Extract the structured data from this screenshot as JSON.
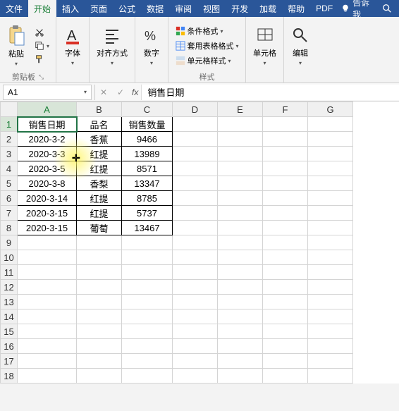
{
  "menubar": {
    "file": "文件",
    "tabs": [
      "开始",
      "插入",
      "页面",
      "公式",
      "数据",
      "审阅",
      "视图",
      "开发",
      "加载",
      "帮助",
      "PDF"
    ],
    "active_index": 0,
    "tellme": "告诉我"
  },
  "ribbon": {
    "clipboard": {
      "paste": "粘贴",
      "label": "剪贴板"
    },
    "font": {
      "label": "字体"
    },
    "align": {
      "label": "对齐方式"
    },
    "number": {
      "label": "数字"
    },
    "styles": {
      "cond_fmt": "条件格式",
      "fmt_table": "套用表格格式",
      "cell_styles": "单元格样式",
      "label": "样式"
    },
    "cells": {
      "label": "单元格"
    },
    "edit": {
      "label": "编辑"
    }
  },
  "namebox": {
    "ref": "A1"
  },
  "formula": {
    "value": "销售日期"
  },
  "chart_data": {
    "type": "table",
    "headers": [
      "销售日期",
      "品名",
      "销售数量"
    ],
    "rows": [
      [
        "2020-3-2",
        "香蕉",
        "9466"
      ],
      [
        "2020-3-3",
        "红提",
        "13989"
      ],
      [
        "2020-3-5",
        "红提",
        "8571"
      ],
      [
        "2020-3-8",
        "香梨",
        "13347"
      ],
      [
        "2020-3-14",
        "红提",
        "8785"
      ],
      [
        "2020-3-15",
        "红提",
        "5737"
      ],
      [
        "2020-3-15",
        "葡萄",
        "13467"
      ]
    ]
  },
  "grid": {
    "cols": [
      "A",
      "B",
      "C",
      "D",
      "E",
      "F",
      "G"
    ],
    "row_count": 18,
    "data_col_count": 3,
    "active": "A1"
  }
}
